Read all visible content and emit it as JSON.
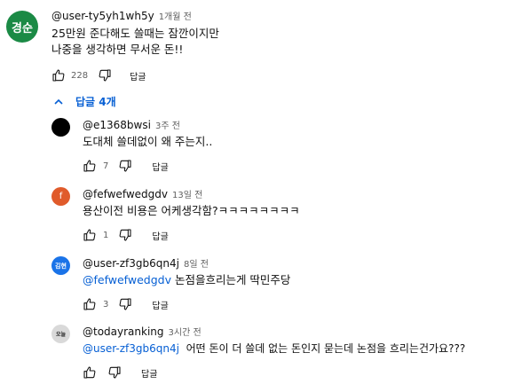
{
  "main_comment": {
    "avatar_text": "경순",
    "avatar_color": "#1b8a45",
    "author": "@user-ty5yh1wh5y",
    "time": "1개월 전",
    "line1": "25만원 준다해도 쓸때는 잠깐이지만",
    "line2": "나중을 생각하면 무서운 돈!!",
    "likes": "228",
    "reply_label": "답글"
  },
  "replies_toggle": {
    "label": "답글 4개"
  },
  "replies": [
    {
      "avatar_color": "#000000",
      "avatar_text": "",
      "author": "@e1368bwsi",
      "time": "3주 전",
      "mention": "",
      "text": "도대체 쓸데없이 왜 주는지..",
      "likes": "7",
      "reply_label": "답글"
    },
    {
      "avatar_color": "#e05b2b",
      "avatar_text": "f",
      "author": "@fefwefwedgdv",
      "time": "13일 전",
      "mention": "",
      "text": "용산이전 비용은 어케생각함?ㅋㅋㅋㅋㅋㅋㅋㅋ",
      "likes": "1",
      "reply_label": "답글"
    },
    {
      "avatar_color": "#1a73e8",
      "avatar_text": "김현",
      "author": "@user-zf3gb6qn4j",
      "time": "8일 전",
      "mention": "@fefwefwedgdv",
      "text": " 논점을흐리는게 딱민주당",
      "likes": "3",
      "reply_label": "답글"
    },
    {
      "avatar_color": "#6d6d6d",
      "avatar_text": "오늘",
      "author": "@todayranking",
      "time": "3시간 전",
      "mention": "@user-zf3gb6qn4j",
      "text": "  어떤 돈이 더 쓸데 없는 돈인지 묻는데 논점을 흐리는건가요???",
      "likes": "",
      "reply_label": "답글"
    }
  ],
  "colors": {
    "link": "#065fd4",
    "meta": "#606060"
  }
}
